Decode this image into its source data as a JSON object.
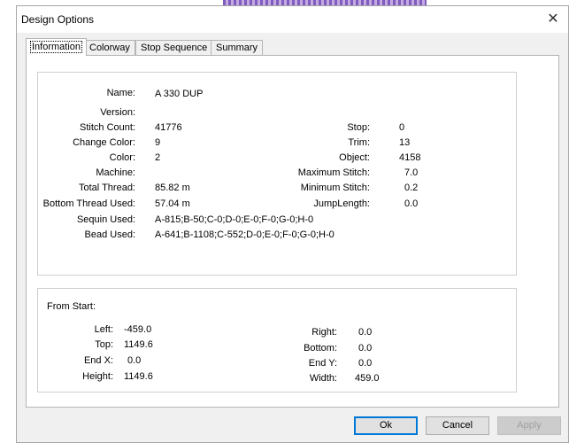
{
  "window": {
    "title": "Design Options",
    "close_glyph": "✕"
  },
  "tabs": [
    {
      "label": "Information",
      "active": true
    },
    {
      "label": "Colorway"
    },
    {
      "label": "Stop Sequence"
    },
    {
      "label": "Summary"
    }
  ],
  "info": {
    "name_label": "Name:",
    "name_value": "A 330 DUP",
    "version_label": "Version:",
    "version_value": "",
    "stitch_count_label": "Stitch Count:",
    "stitch_count_value": "41776",
    "change_color_label": "Change Color:",
    "change_color_value": "9",
    "color_label": "Color:",
    "color_value": "2",
    "machine_label": "Machine:",
    "machine_value": "",
    "total_thread_label": "Total Thread:",
    "total_thread_value": "85.82 m",
    "bottom_thread_label": "Bottom Thread Used:",
    "bottom_thread_value": "57.04 m",
    "sequin_label": "Sequin Used:",
    "sequin_value": "A-815;B-50;C-0;D-0;E-0;F-0;G-0;H-0",
    "bead_label": "Bead Used:",
    "bead_value": "A-641;B-1108;C-552;D-0;E-0;F-0;G-0;H-0",
    "stop_label": "Stop:",
    "stop_value": "0",
    "trim_label": "Trim:",
    "trim_value": "13",
    "object_label": "Object:",
    "object_value": "4158",
    "max_stitch_label": "Maximum Stitch:",
    "max_stitch_value": "7.0",
    "min_stitch_label": "Minimum Stitch:",
    "min_stitch_value": "0.2",
    "jump_length_label": "JumpLength:",
    "jump_length_value": "0.0"
  },
  "from_start": {
    "title": "From Start:",
    "left_label": "Left:",
    "left_value": "-459.0",
    "top_label": "Top:",
    "top_value": "1149.6",
    "end_x_label": "End X:",
    "end_x_value": "0.0",
    "height_label": "Height:",
    "height_value": "1149.6",
    "right_label": "Right:",
    "right_value": "0.0",
    "bottom_label": "Bottom:",
    "bottom_value": "0.0",
    "end_y_label": "End Y:",
    "end_y_value": "0.0",
    "width_label": "Width:",
    "width_value": "459.0"
  },
  "buttons": {
    "ok": "Ok",
    "cancel": "Cancel",
    "apply": "Apply"
  }
}
